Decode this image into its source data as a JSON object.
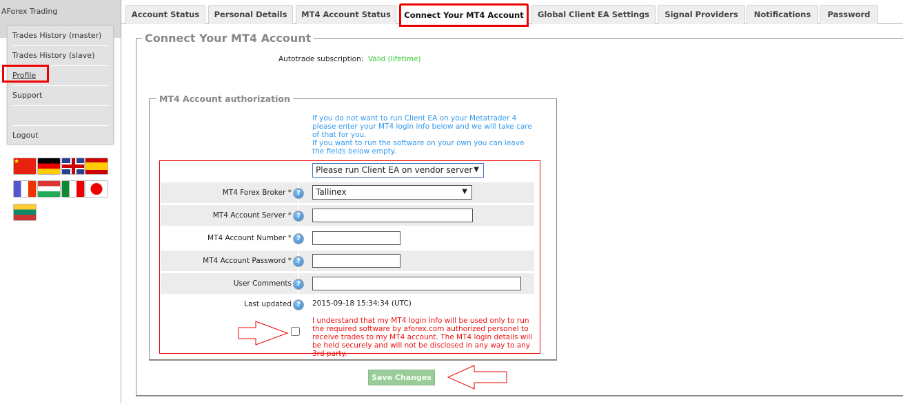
{
  "sidebar": {
    "brand": "AForex Trading",
    "items": [
      {
        "label": "Trades History (master)"
      },
      {
        "label": "Trades History (slave)"
      },
      {
        "label": "Profile"
      },
      {
        "label": "Support"
      },
      {
        "label": ""
      },
      {
        "label": "Logout"
      }
    ],
    "flags": [
      "china",
      "germany",
      "united-kingdom",
      "spain",
      "france",
      "hungary",
      "italy",
      "japan",
      "lithuania"
    ]
  },
  "tabs": [
    {
      "label": "Account Status"
    },
    {
      "label": "Personal Details"
    },
    {
      "label": "MT4 Account Status"
    },
    {
      "label": "Connect Your MT4 Account"
    },
    {
      "label": "Global Client EA Settings"
    },
    {
      "label": "Signal Providers"
    },
    {
      "label": "Notifications"
    },
    {
      "label": "Password"
    }
  ],
  "main": {
    "title": "Connect Your MT4 Account",
    "subscription_label": "Autotrade subscription:",
    "subscription_value": "Valid (lifetime)",
    "auth": {
      "legend": "MT4 Account authorization",
      "info1": "If you do not want to run Client EA on your Metatrader 4 please enter your MT4 login info below and we will take care of that for you.",
      "info2": "If you want to run the software on your own you can leave the fields below empty.",
      "mode_select": "Please run Client EA on vendor server",
      "broker_label": "MT4 Forex Broker *",
      "broker_value": "Tallinex",
      "server_label": "MT4 Account Server *",
      "server_value": "",
      "number_label": "MT4 Account Number *",
      "number_value": "",
      "password_label": "MT4 Account Password *",
      "password_value": "",
      "comments_label": "User Comments",
      "comments_value": "",
      "updated_label": "Last updated",
      "updated_value": "2015-09-18 15:34:34 (UTC)",
      "agreement": "I understand that my MT4 login info will be used only to run the required software by aforex.com authorized personel to receive trades to my MT4 account. The MT4 login details will be held securely and will not be disclosed in any way to any 3rd party.",
      "agreement_checked": false
    },
    "save_label": "Save Changes"
  },
  "colors": {
    "valid": "#33cc33",
    "info": "#3399ee",
    "warning": "#ee1111",
    "save": "#99cc99",
    "highlight": "#e00000"
  }
}
